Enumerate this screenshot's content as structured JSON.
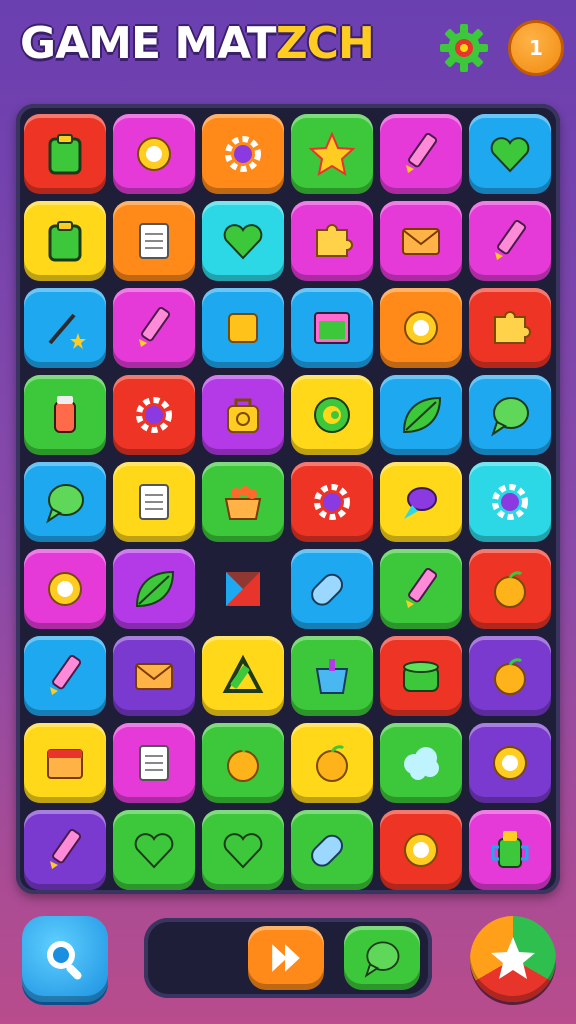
{
  "header": {
    "title_main": "GAME MAT",
    "title_accent": "ZCH",
    "settings_icon": "gear-icon",
    "coin_label": "1"
  },
  "colors": {
    "red": "#ee3424",
    "magenta": "#e53ad8",
    "orange": "#ff8a1a",
    "green": "#3cc83a",
    "purple": "#b43ae8",
    "blue": "#1ea8f0",
    "yellow": "#ffd81a",
    "cyan": "#2cd8e6",
    "violet": "#7a3ad0"
  },
  "board": {
    "rows": [
      [
        {
          "c": "red",
          "icon": "clipboard"
        },
        {
          "c": "magenta",
          "icon": "sun"
        },
        {
          "c": "orange",
          "icon": "gear"
        },
        {
          "c": "green",
          "icon": "star"
        },
        {
          "c": "magenta",
          "icon": "pencil"
        },
        {
          "c": "blue",
          "icon": "heart"
        }
      ],
      [
        {
          "c": "yellow",
          "icon": "clipboard"
        },
        {
          "c": "orange",
          "icon": "notepad"
        },
        {
          "c": "cyan",
          "icon": "heart"
        },
        {
          "c": "magenta",
          "icon": "puzzle"
        },
        {
          "c": "magenta",
          "icon": "envelope"
        },
        {
          "c": "magenta",
          "icon": "pencil"
        }
      ],
      [
        {
          "c": "blue",
          "icon": "wand"
        },
        {
          "c": "magenta",
          "icon": "pencil"
        },
        {
          "c": "blue",
          "icon": "square"
        },
        {
          "c": "blue",
          "icon": "window"
        },
        {
          "c": "orange",
          "icon": "sun"
        },
        {
          "c": "red",
          "icon": "puzzle"
        }
      ],
      [
        {
          "c": "green",
          "icon": "jar"
        },
        {
          "c": "red",
          "icon": "gear"
        },
        {
          "c": "purple",
          "icon": "bag"
        },
        {
          "c": "yellow",
          "icon": "spiral"
        },
        {
          "c": "blue",
          "icon": "leaf"
        },
        {
          "c": "blue",
          "icon": "bubble"
        }
      ],
      [
        {
          "c": "blue",
          "icon": "bubble"
        },
        {
          "c": "yellow",
          "icon": "notepad"
        },
        {
          "c": "green",
          "icon": "basket"
        },
        {
          "c": "red",
          "icon": "gear"
        },
        {
          "c": "yellow",
          "icon": "gem"
        },
        {
          "c": "cyan",
          "icon": "gear"
        }
      ],
      [
        {
          "c": "magenta",
          "icon": "sun"
        },
        {
          "c": "purple",
          "icon": "leaf"
        },
        {
          "c": "empty",
          "icon": "cube"
        },
        {
          "c": "blue",
          "icon": "roller"
        },
        {
          "c": "green",
          "icon": "pencil"
        },
        {
          "c": "red",
          "icon": "fruit"
        }
      ],
      [
        {
          "c": "blue",
          "icon": "pencil"
        },
        {
          "c": "violet",
          "icon": "envelope"
        },
        {
          "c": "yellow",
          "icon": "ruler"
        },
        {
          "c": "green",
          "icon": "bucket"
        },
        {
          "c": "red",
          "icon": "pot"
        },
        {
          "c": "violet",
          "icon": "fruit"
        }
      ],
      [
        {
          "c": "yellow",
          "icon": "calendar"
        },
        {
          "c": "magenta",
          "icon": "notepad"
        },
        {
          "c": "green",
          "icon": "fruit"
        },
        {
          "c": "yellow",
          "icon": "fruit"
        },
        {
          "c": "green",
          "icon": "cloud"
        },
        {
          "c": "violet",
          "icon": "sun"
        }
      ],
      [
        {
          "c": "violet",
          "icon": "pencil"
        },
        {
          "c": "green",
          "icon": "heart"
        },
        {
          "c": "green",
          "icon": "heart"
        },
        {
          "c": "green",
          "icon": "roller"
        },
        {
          "c": "red",
          "icon": "sun"
        },
        {
          "c": "magenta",
          "icon": "cup"
        }
      ]
    ]
  },
  "controls": {
    "search_icon": "magnifier-icon",
    "tray": [
      {
        "c": "orange",
        "icon": "play"
      },
      {
        "c": "green",
        "icon": "bubble"
      }
    ],
    "star_icon": "star-icon"
  }
}
